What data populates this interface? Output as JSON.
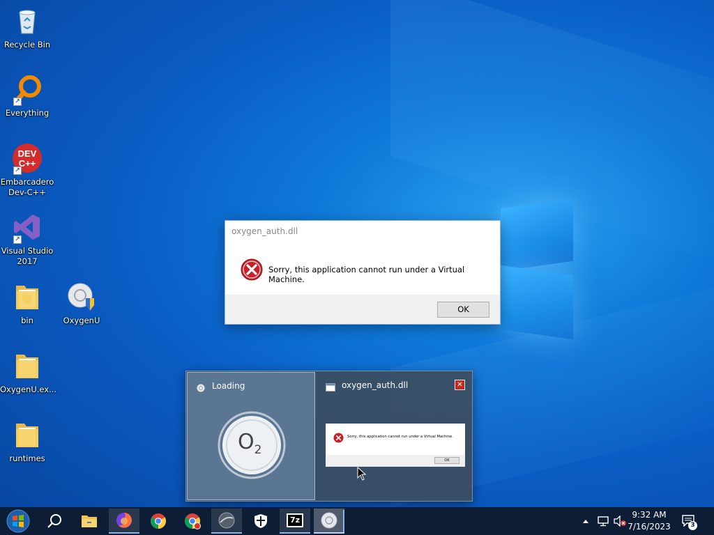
{
  "desktop": {
    "icons": [
      {
        "label": "Recycle Bin",
        "icon": "recycle-bin-icon"
      },
      {
        "label": "Everything",
        "icon": "everything-search-icon"
      },
      {
        "label": "Embarcadero Dev-C++",
        "icon": "devcpp-icon",
        "badge": "DEV C++"
      },
      {
        "label": "Visual Studio 2017",
        "icon": "visual-studio-icon"
      },
      {
        "label": "bin",
        "icon": "folder-icon"
      },
      {
        "label": "OxygenU",
        "icon": "oxygenu-icon"
      },
      {
        "label": "OxygenU.ex...",
        "icon": "folder-icon"
      },
      {
        "label": "runtimes",
        "icon": "folder-icon"
      }
    ]
  },
  "dialog": {
    "title": "oxygen_auth.dll",
    "message": "Sorry, this application cannot run under a Virtual Machine.",
    "ok_label": "OK"
  },
  "preview": {
    "loading": {
      "title": "Loading",
      "logo_text": "O",
      "logo_sub": "2"
    },
    "dll": {
      "title": "oxygen_auth.dll",
      "close_label": "✕",
      "mini_message": "Sorry, this application cannot run under a Virtual Machine.",
      "mini_ok": "OK"
    }
  },
  "taskbar": {
    "apps": [
      "start-icon",
      "search-icon",
      "file-explorer-icon",
      "firefox-icon",
      "chrome-icon",
      "chrome-dev-icon",
      "app-icon",
      "defender-icon",
      "7zip-icon",
      "oxygenu-icon"
    ],
    "zip_label": "7z",
    "clock_time": "9:32 AM",
    "clock_date": "7/16/2023",
    "notif_count": "3"
  },
  "colors": {
    "taskbar": "#0d1d36",
    "error": "#c42b1c",
    "accent": "#0e78d8"
  }
}
